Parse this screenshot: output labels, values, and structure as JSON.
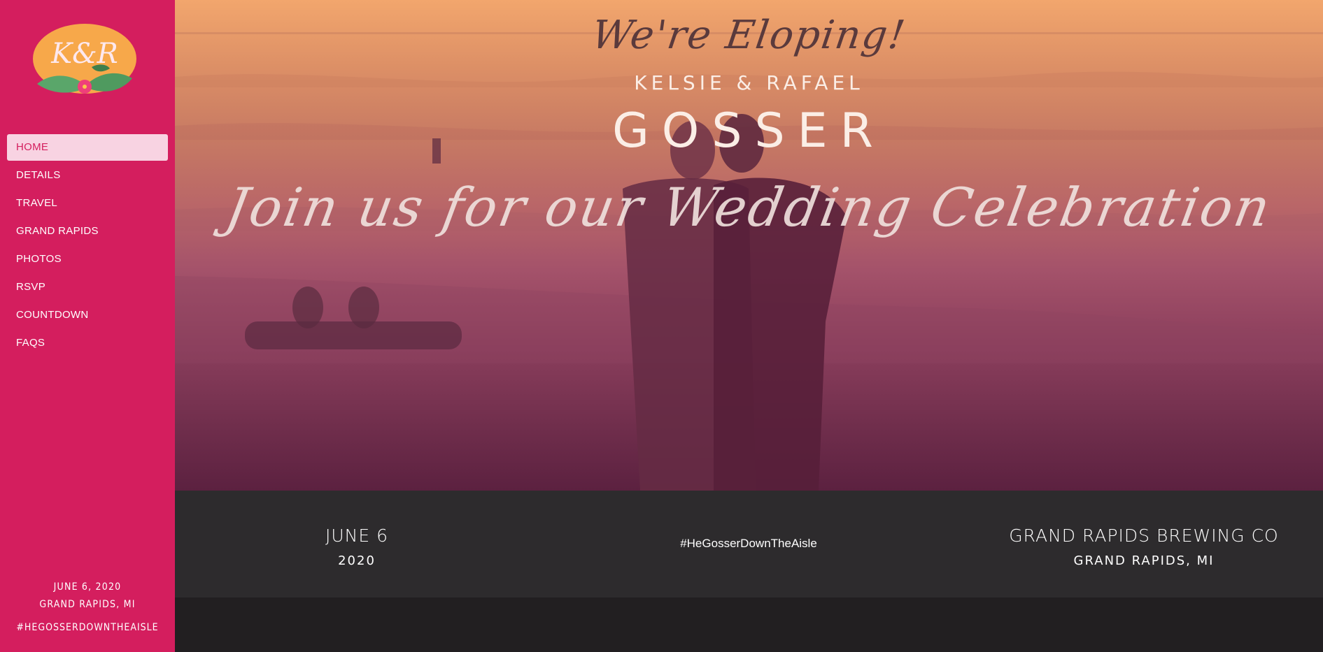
{
  "logo": {
    "monogram": "K&R"
  },
  "nav": {
    "items": [
      {
        "label": "HOME",
        "active": true
      },
      {
        "label": "DETAILS"
      },
      {
        "label": "TRAVEL"
      },
      {
        "label": "GRAND RAPIDS"
      },
      {
        "label": "PHOTOS"
      },
      {
        "label": "RSVP"
      },
      {
        "label": "COUNTDOWN"
      },
      {
        "label": "FAQS"
      }
    ]
  },
  "sidebar_footer": {
    "date": "JUNE 6, 2020",
    "location": "GRAND RAPIDS, MI",
    "hashtag": "#HEGOSSERDOWNTHEAISLE"
  },
  "hero": {
    "eloping": "We're Eloping!",
    "names": "KELSIE & RAFAEL",
    "surname": "GOSSER",
    "tagline": "Join us for our Wedding Celebration"
  },
  "info": {
    "date_main": "JUNE 6",
    "date_year": "2020",
    "hashtag": "#HeGosserDownTheAisle",
    "venue": "GRAND RAPIDS BREWING CO",
    "venue_city": "GRAND RAPIDS, MI"
  },
  "colors": {
    "sidebar": "#d41e5e",
    "active_nav_bg": "#f8d3e2",
    "band": "#2d2b2d",
    "page": "#221f21"
  }
}
